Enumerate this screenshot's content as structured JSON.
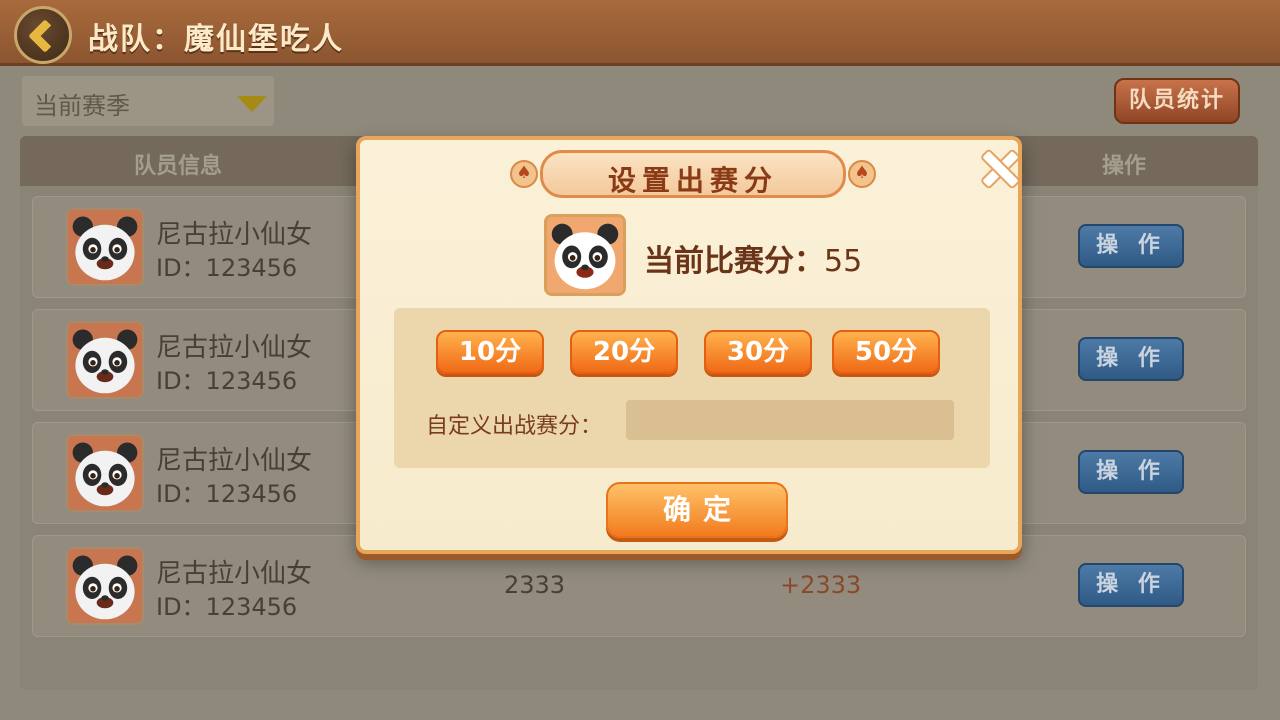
{
  "header": {
    "team_title": "战队：魔仙堡吃人"
  },
  "toolbar": {
    "season_select_value": "当前赛季",
    "stats_button_label": "队员统计"
  },
  "table": {
    "columns": [
      "队员信息",
      "操作"
    ],
    "rows": [
      {
        "nickname": "尼古拉小仙女",
        "id": "ID：123456",
        "score": "",
        "delta": "",
        "action": "操 作"
      },
      {
        "nickname": "尼古拉小仙女",
        "id": "ID：123456",
        "score": "",
        "delta": "",
        "action": "操 作"
      },
      {
        "nickname": "尼古拉小仙女",
        "id": "ID：123456",
        "score": "",
        "delta": "",
        "action": "操 作"
      },
      {
        "nickname": "尼古拉小仙女",
        "id": "ID：123456",
        "score": "2333",
        "delta": "+2333",
        "action": "操 作"
      }
    ]
  },
  "modal": {
    "title": "设置出赛分",
    "current_score_label": "当前比赛分：",
    "current_score_value": "55",
    "chips": [
      "10分",
      "20分",
      "30分",
      "50分"
    ],
    "custom_label": "自定义出战赛分：",
    "custom_value": "",
    "confirm_label": "确定"
  },
  "icons": {
    "back": "back-arrow-icon",
    "dropdown": "dropdown-triangle-icon",
    "close": "close-icon",
    "spade": "spade-icon",
    "avatar": "panda-avatar"
  },
  "colors": {
    "accent_orange": "#f27b1e",
    "action_blue": "#2f5a85",
    "modal_bg": "#fbf1d8",
    "title_brown": "#8a3a14"
  }
}
